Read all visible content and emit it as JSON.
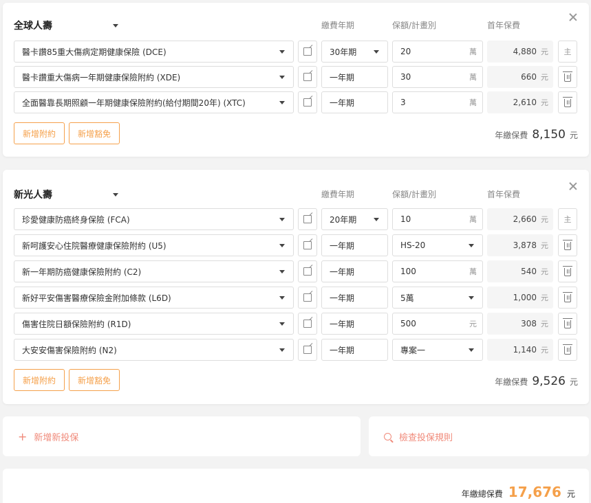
{
  "columns": {
    "term": "繳費年期",
    "amount": "保額/計畫別",
    "premium": "首年保費"
  },
  "companies": [
    {
      "name": "全球人壽",
      "rows": [
        {
          "plan": "醫卡讚85重大傷病定期健康保險 (DCE)",
          "term": "30年期",
          "term_dropdown": true,
          "amount": "20",
          "amount_dropdown": false,
          "unit": "萬",
          "premium": "4,880",
          "action": "主"
        },
        {
          "plan": "醫卡讚重大傷病一年期健康保險附約 (XDE)",
          "term": "一年期",
          "term_dropdown": false,
          "amount": "30",
          "amount_dropdown": false,
          "unit": "萬",
          "premium": "660",
          "action": "trash"
        },
        {
          "plan": "全面醫靠長期照顧一年期健康保險附約(給付期間20年) (XTC)",
          "term": "一年期",
          "term_dropdown": false,
          "amount": "3",
          "amount_dropdown": false,
          "unit": "萬",
          "premium": "2,610",
          "action": "trash"
        }
      ],
      "add_rider": "新增附約",
      "add_waiver": "新增豁免",
      "annual_label": "年繳保費",
      "annual_value": "8,150",
      "currency": "元"
    },
    {
      "name": "新光人壽",
      "rows": [
        {
          "plan": "珍愛健康防癌終身保險 (FCA)",
          "term": "20年期",
          "term_dropdown": true,
          "amount": "10",
          "amount_dropdown": false,
          "unit": "萬",
          "premium": "2,660",
          "action": "主"
        },
        {
          "plan": "新呵護安心住院醫療健康保險附約 (U5)",
          "term": "一年期",
          "term_dropdown": false,
          "amount": "HS-20",
          "amount_dropdown": true,
          "unit": "",
          "premium": "3,878",
          "action": "trash"
        },
        {
          "plan": "新一年期防癌健康保險附約 (C2)",
          "term": "一年期",
          "term_dropdown": false,
          "amount": "100",
          "amount_dropdown": false,
          "unit": "萬",
          "premium": "540",
          "action": "trash"
        },
        {
          "plan": "新好平安傷害醫療保險金附加條款 (L6D)",
          "term": "一年期",
          "term_dropdown": false,
          "amount": "5萬",
          "amount_dropdown": true,
          "unit": "",
          "premium": "1,000",
          "action": "trash"
        },
        {
          "plan": "傷害住院日額保險附約 (R1D)",
          "term": "一年期",
          "term_dropdown": false,
          "amount": "500",
          "amount_dropdown": false,
          "unit": "元",
          "premium": "308",
          "action": "trash"
        },
        {
          "plan": "大安安傷害保險附約 (N2)",
          "term": "一年期",
          "term_dropdown": false,
          "amount": "專案一",
          "amount_dropdown": true,
          "unit": "",
          "premium": "1,140",
          "action": "trash"
        }
      ],
      "add_rider": "新增附約",
      "add_waiver": "新增豁免",
      "annual_label": "年繳保費",
      "annual_value": "9,526",
      "currency": "元"
    }
  ],
  "add_policy": "新增新投保",
  "check_rules": "檢查投保規則",
  "total": {
    "label": "年繳總保費",
    "value": "17,676",
    "currency": "元"
  },
  "colors": {
    "accent": "#f5a04a",
    "link": "#f08a7a"
  }
}
